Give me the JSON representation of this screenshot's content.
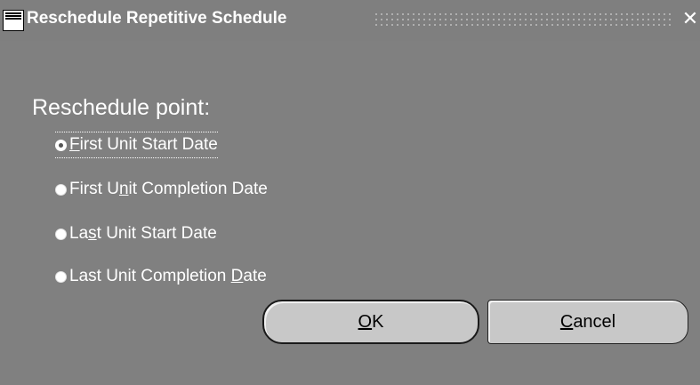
{
  "window": {
    "title": "Reschedule Repetitive Schedule",
    "close_glyph": "✕",
    "icon": "oracle-app-icon"
  },
  "group": {
    "label": "Reschedule point:"
  },
  "options": [
    {
      "pre": "",
      "key": "F",
      "post": "irst Unit Start Date",
      "selected": true
    },
    {
      "pre": "First U",
      "key": "n",
      "post": "it Completion Date",
      "selected": false
    },
    {
      "pre": "La",
      "key": "s",
      "post": "t Unit Start Date",
      "selected": false
    },
    {
      "pre": "Last Unit Completion ",
      "key": "D",
      "post": "ate",
      "selected": false
    }
  ],
  "buttons": {
    "ok": {
      "key": "O",
      "rest": "K"
    },
    "cancel": {
      "key": "C",
      "rest": "ancel"
    }
  },
  "colors": {
    "background": "#808080",
    "text": "#ffffff",
    "button_face": "#c8c8c8"
  }
}
